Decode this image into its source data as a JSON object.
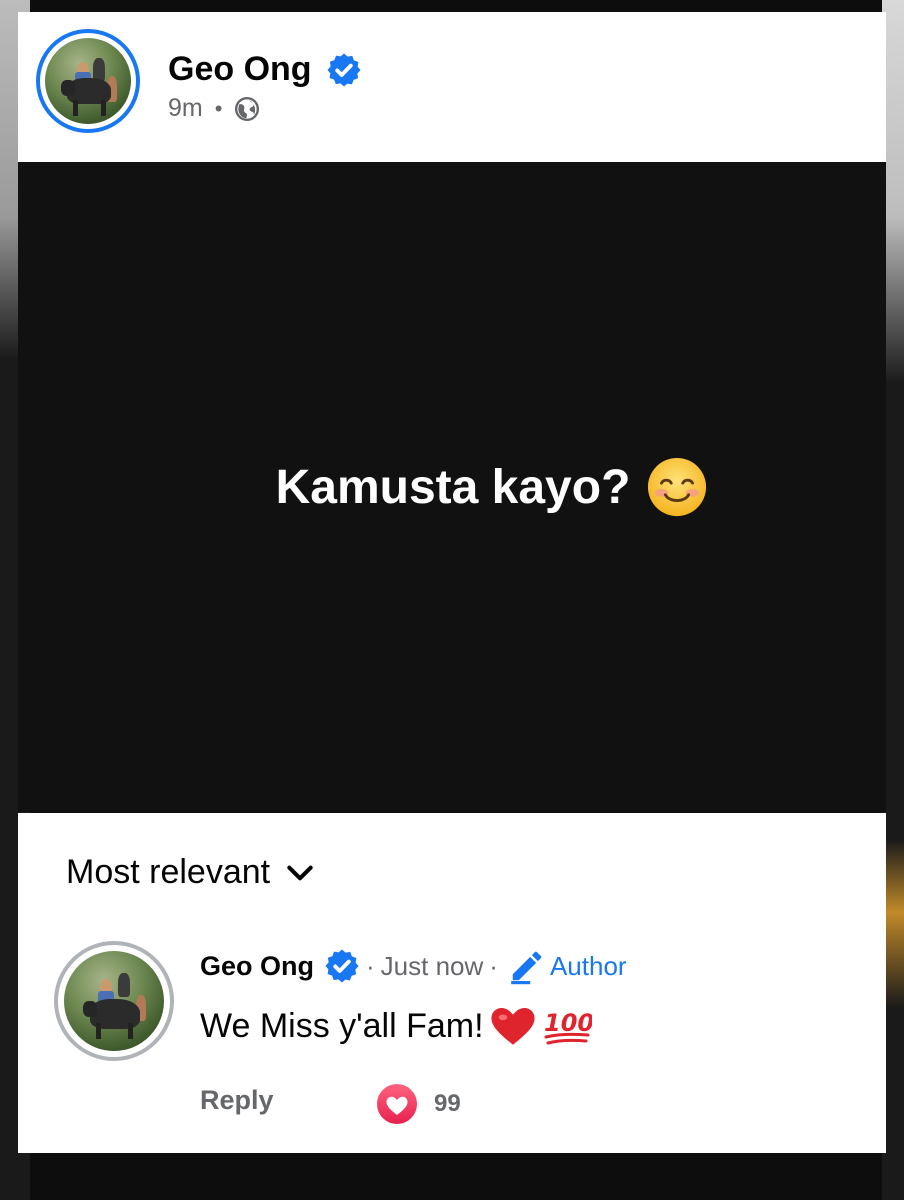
{
  "post": {
    "author": "Geo Ong",
    "time": "9m",
    "separator": "•",
    "text": "Kamusta kayo?",
    "emoji_icon": "smiling-face-icon"
  },
  "comments": {
    "sort_label": "Most relevant",
    "items": [
      {
        "author": "Geo Ong",
        "sep1": "·",
        "time": "Just now",
        "sep2": "·",
        "badge_label": "Author",
        "text": "We Miss y'all Fam!",
        "emojis": [
          "red-heart-icon",
          "hundred-points-icon"
        ],
        "reply_label": "Reply",
        "reaction_icon": "love-reaction-icon",
        "reaction_count": "99"
      }
    ]
  },
  "colors": {
    "accent_blue": "#1877f2",
    "secondary_text": "#65676b",
    "post_background": "#111111",
    "love_red": "#f33e58"
  }
}
